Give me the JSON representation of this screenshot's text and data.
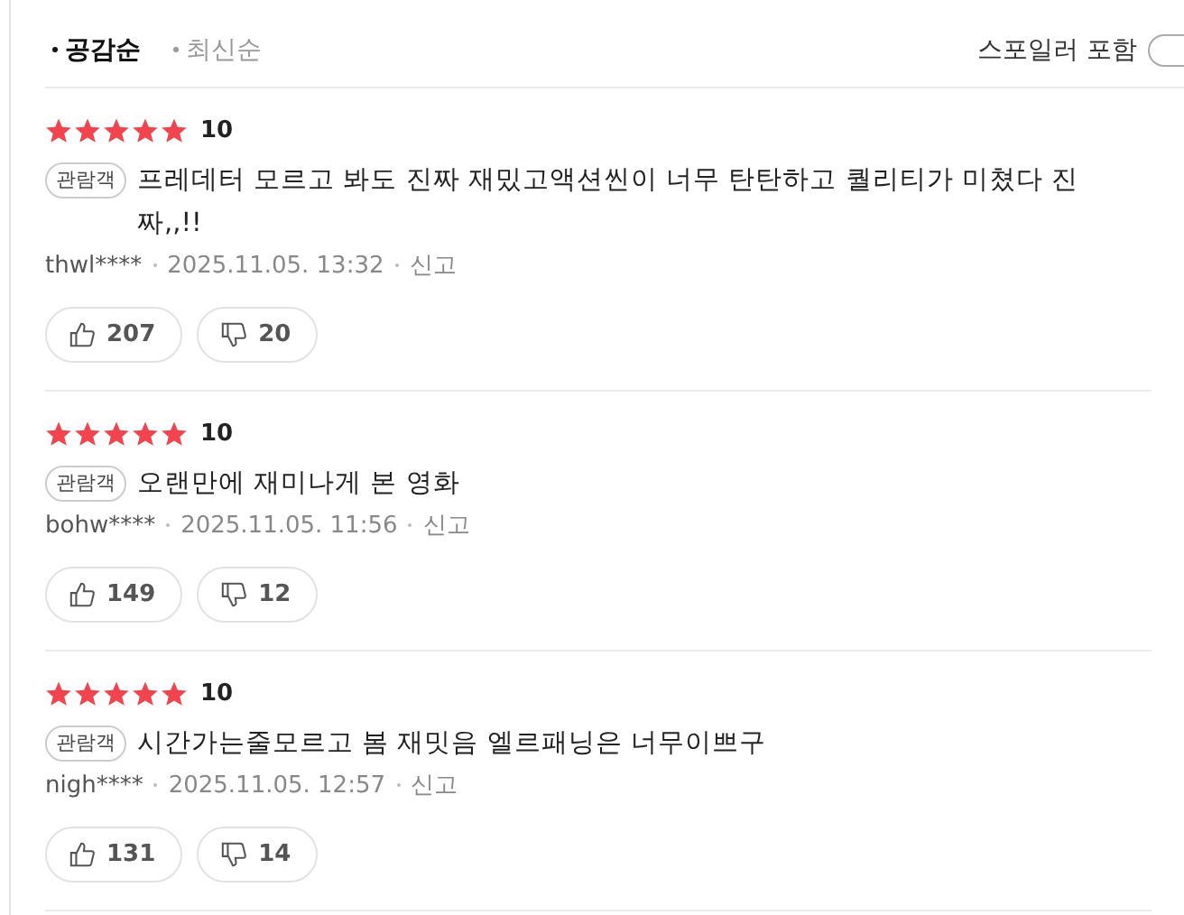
{
  "sort_tabs": [
    {
      "label": "공감순",
      "selected": true
    },
    {
      "label": "최신순",
      "selected": false
    }
  ],
  "spoiler": {
    "label": "스포일러 포함",
    "on": false
  },
  "reviews": [
    {
      "stars": 5,
      "score": "10",
      "badge": "관람객",
      "text": "프레데터 모르고 봐도 진짜 재밌고액션씬이 너무 탄탄하고 퀄리티가 미쳤다 진짜,,!!",
      "user": "thwl****",
      "date": "2025.11.05. 13:32",
      "report": "신고",
      "likes": "207",
      "dislikes": "20"
    },
    {
      "stars": 5,
      "score": "10",
      "badge": "관람객",
      "text": "오랜만에 재미나게 본 영화",
      "user": "bohw****",
      "date": "2025.11.05. 11:56",
      "report": "신고",
      "likes": "149",
      "dislikes": "12"
    },
    {
      "stars": 5,
      "score": "10",
      "badge": "관람객",
      "text": "시간가는줄모르고 봄 재밋음 엘르패닝은 너무이쁘구",
      "user": "nigh****",
      "date": "2025.11.05. 12:57",
      "report": "신고",
      "likes": "131",
      "dislikes": "14"
    }
  ]
}
